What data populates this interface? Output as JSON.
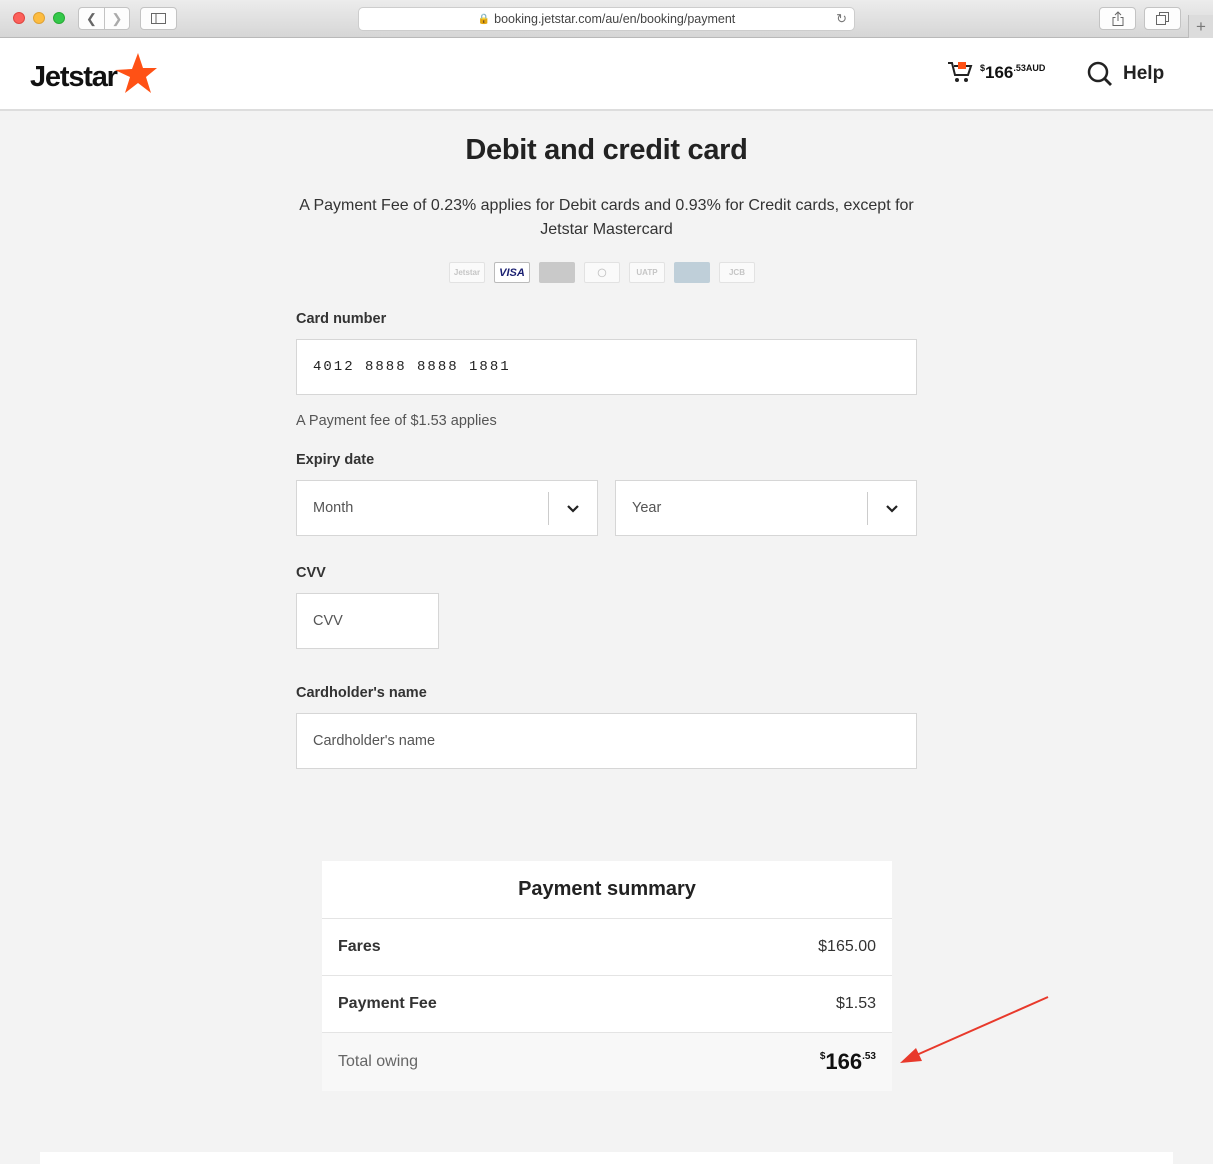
{
  "browser": {
    "url": "booking.jetstar.com/au/en/booking/payment"
  },
  "header": {
    "logo_text": "Jetstar",
    "cart": {
      "currency_symbol": "$",
      "amount_whole": "166",
      "amount_cents_currency": ".53AUD"
    },
    "help_label": "Help"
  },
  "page": {
    "title": "Debit and credit card",
    "fee_note": "A Payment Fee of 0.23% applies for Debit cards and 0.93% for Credit cards, except for Jetstar Mastercard",
    "card_logos": [
      "Jetstar Mastercard",
      "VISA",
      "MasterCard",
      "Diners Club",
      "UATP",
      "American Express",
      "JCB"
    ]
  },
  "form": {
    "card_number_label": "Card number",
    "card_number_value": "4012 8888 8888 1881",
    "payment_fee_note": "A Payment fee of $1.53 applies",
    "expiry_label": "Expiry date",
    "month_value": "Month",
    "year_value": "Year",
    "cvv_label": "CVV",
    "cvv_placeholder": "CVV",
    "cardholder_label": "Cardholder's name",
    "cardholder_placeholder": "Cardholder's name"
  },
  "summary": {
    "title": "Payment summary",
    "rows": [
      {
        "label": "Fares",
        "value": "$165.00"
      },
      {
        "label": "Payment Fee",
        "value": "$1.53"
      }
    ],
    "total_label": "Total owing",
    "total_currency": "$",
    "total_whole": "166",
    "total_cents": ".53"
  },
  "colors": {
    "brand_orange": "#ff5115",
    "annotation_arrow": "#e8392b"
  }
}
